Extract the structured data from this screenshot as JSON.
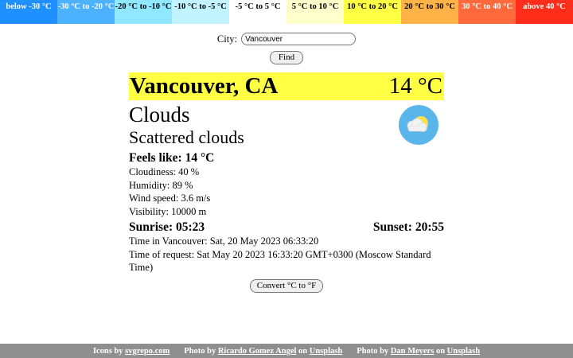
{
  "legend": [
    {
      "label": "below -30 °C",
      "bg": "#1e90ff",
      "fg": "light"
    },
    {
      "label": "-30 °C to -20 °C",
      "bg": "#4cb1ff",
      "fg": "light"
    },
    {
      "label": "-20 °C to -10 °C",
      "bg": "#8fe8ff",
      "fg": "dark"
    },
    {
      "label": "-10 °C to -5 °C",
      "bg": "#c2f4ff",
      "fg": "dark"
    },
    {
      "label": "-5 °C to 5 °C",
      "bg": "#ffffff",
      "fg": "dark"
    },
    {
      "label": "5 °C to 10 °C",
      "bg": "#ffffcc",
      "fg": "dark"
    },
    {
      "label": "10 °C to 20 °C",
      "bg": "#ffff44",
      "fg": "dark"
    },
    {
      "label": "20 °C to 30 °C",
      "bg": "#ffb347",
      "fg": "dark"
    },
    {
      "label": "30 °C to 40 °C",
      "bg": "#ff6a3d",
      "fg": "light"
    },
    {
      "label": "above 40 °C",
      "bg": "#ff2d1a",
      "fg": "light"
    }
  ],
  "search": {
    "label": "City:",
    "value": "Vancouver",
    "button": "Find"
  },
  "weather": {
    "city": "Vancouver, CA",
    "temperature": "14 °C",
    "condition": "Clouds",
    "description": "Scattered clouds",
    "icon": "scattered-clouds-icon",
    "feels_like": "Feels like: 14 °C",
    "cloudiness": "Cloudiness: 40 %",
    "humidity": "Humidity: 89 %",
    "wind": "Wind speed: 3.6 m/s",
    "visibility": "Visibility: 10000 m",
    "sunrise": "Sunrise: 05:23",
    "sunset": "Sunset: 20:55",
    "local_time": "Time in Vancouver: Sat, 20 May 2023 06:33:20",
    "request_time": "Time of request: Sat May 20 2023 16:33:20 GMT+0300 (Moscow Standard Time)",
    "convert_button": "Convert °C to °F"
  },
  "colors": {
    "header_bg": "#ffff44",
    "icon_circle": "#5ab6ea",
    "footer_bg": "#8f8f8f"
  },
  "footer": {
    "icons_prefix": "Icons by",
    "icons_link": "svgrepo.com",
    "photo1_prefix": "Photo by",
    "photo1_author": "Ricardo Gomez Angel",
    "photo1_on": "on",
    "photo1_site": "Unsplash",
    "photo2_prefix": "Photo by",
    "photo2_author": "Dan Meyers",
    "photo2_on": "on",
    "photo2_site": "Unsplash"
  }
}
